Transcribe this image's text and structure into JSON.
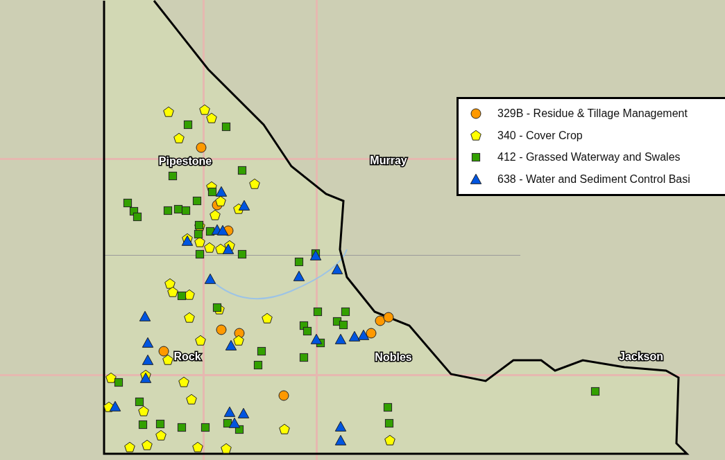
{
  "counties": [
    {
      "label": "Pipestone"
    },
    {
      "label": "Murray"
    },
    {
      "label": "Rock"
    },
    {
      "label": "Nobles"
    },
    {
      "label": "Jackson"
    }
  ],
  "legend": [
    {
      "kind": "circle",
      "label": "329B - Residue & Tillage Management",
      "color": "#ff9900"
    },
    {
      "kind": "pentagon",
      "label": "340 - Cover Crop",
      "color": "#ffff00"
    },
    {
      "kind": "square",
      "label": "412 - Grassed Waterway and Swales",
      "color": "#33a000"
    },
    {
      "kind": "triangle",
      "label": "638 - Water and Sediment Control Basi",
      "color": "#0055e0"
    }
  ]
}
